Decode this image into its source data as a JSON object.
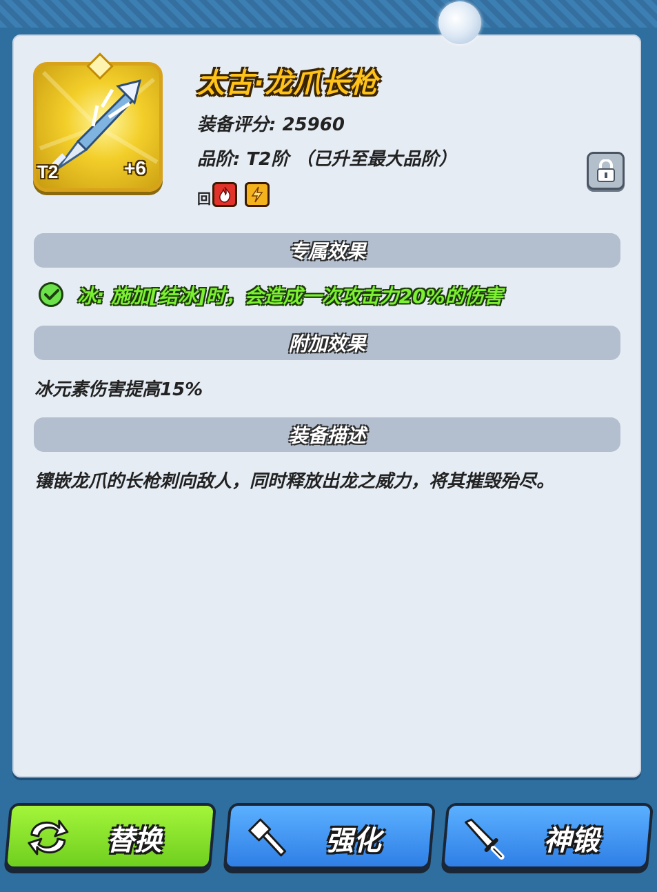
{
  "item": {
    "name": "太古·龙爪长枪",
    "score_line": "装备评分: 25960",
    "tier_line": "品阶: T2阶 （已升至最大品阶）",
    "tier_badge": "T2",
    "enhance_level": "+6",
    "element_prefix": "回",
    "elements": [
      "fire-icon",
      "thunder-icon"
    ]
  },
  "sections": {
    "exclusive": {
      "title": "专属效果",
      "effect": "冰: 施加[结冰]时，会造成一次攻击力20%的伤害"
    },
    "bonus": {
      "title": "附加效果",
      "text": "冰元素伤害提高15%"
    },
    "description": {
      "title": "装备描述",
      "text": "镶嵌龙爪的长枪刺向敌人，同时释放出龙之威力，将其摧毁殆尽。"
    }
  },
  "buttons": {
    "replace": "替换",
    "enhance": "强化",
    "forge": "神锻"
  },
  "colors": {
    "item_name": "#ffc21a",
    "exclusive_effect": "#7cf032",
    "replace_button": "#8ee52c",
    "action_button": "#3f8ff2"
  }
}
